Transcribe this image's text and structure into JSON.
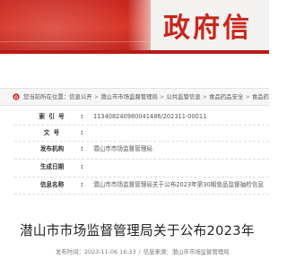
{
  "site": {
    "title": "政府信"
  },
  "breadcrumb": {
    "prefix": "您当前所在位置：",
    "items": [
      "信息公开",
      "潜山市市场监督管理局",
      "公共监管信息",
      "食品药品安全",
      "食品药品监督抽"
    ],
    "separator": ">"
  },
  "info": {
    "rows": [
      {
        "label": "索 引 号",
        "value": "11340824098004148​6/202311-00011"
      },
      {
        "label": "文    号",
        "value": ""
      },
      {
        "label": "发布机构",
        "value": "潜山市市场监督管理局"
      },
      {
        "label": "生成日期",
        "value": ""
      },
      {
        "label": "信息名称",
        "value": "潜山市市场监督管理局关于公布2023年第30期食品监督抽检信息"
      }
    ]
  },
  "article": {
    "title": "潜山市市场监督管理局关于公布2023年",
    "date_prefix": "发布时间：",
    "date": "2023-11-06 16:33",
    "source_prefix": "信息来源：",
    "source": "潜山市市场监督管理局"
  },
  "colors": {
    "brand_red": "#c8261d"
  },
  "icons": {
    "breadcrumb": "home-icon"
  }
}
